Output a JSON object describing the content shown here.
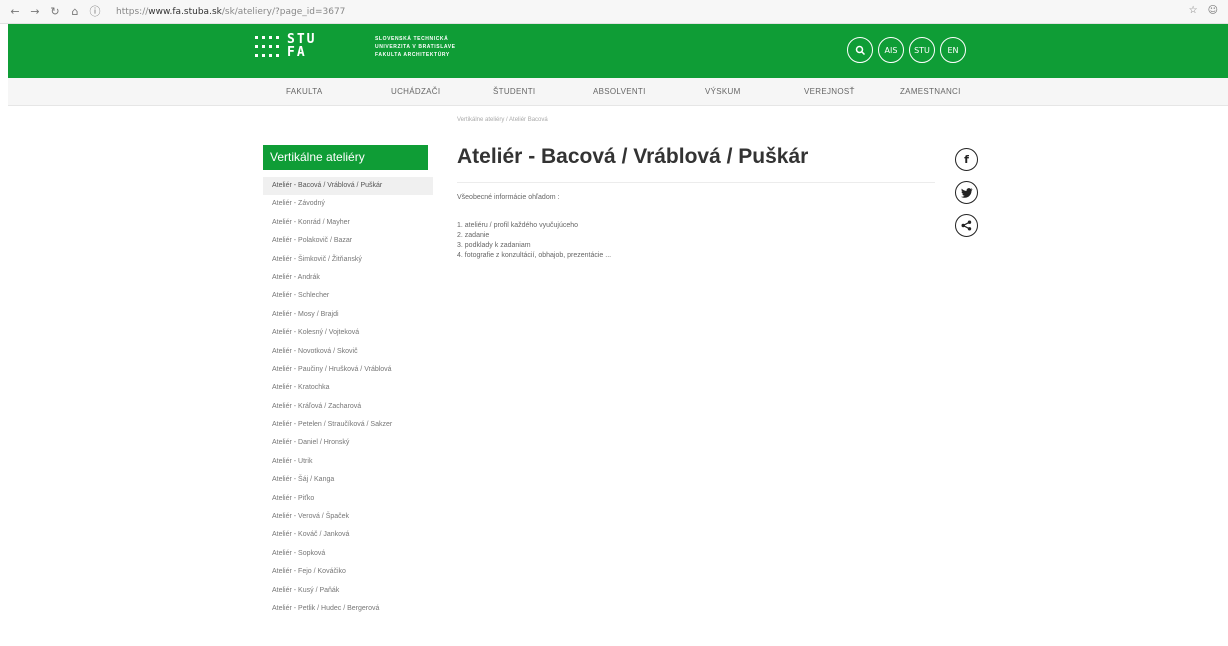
{
  "browser": {
    "url_prefix": "https://",
    "url_domain": "www.fa.stuba.sk",
    "url_path": "/sk/ateliery/?page_id=3677"
  },
  "header": {
    "logo_line1": "STU",
    "logo_line2": "FA",
    "faculty_lines": [
      "SLOVENSKÁ TECHNICKÁ",
      "UNIVERZITA V BRATISLAVE",
      "FAKULTA ARCHITEKTÚRY"
    ],
    "buttons": [
      "AIS",
      "STU",
      "EN"
    ]
  },
  "nav": {
    "items": [
      "FAKULTA",
      "UCHÁDZAČI",
      "ŠTUDENTI",
      "ABSOLVENTI",
      "VÝSKUM",
      "VEREJNOSŤ",
      "ZAMESTNANCI"
    ]
  },
  "breadcrumb": "Vertikálne ateliéry  /  Ateliér Bacová",
  "sidebar": {
    "title": "Vertikálne ateliéry",
    "items": [
      "Ateliér - Bacová / Vráblová / Puškár",
      "Ateliér - Závodný",
      "Ateliér - Konrád / Mayher",
      "Ateliér - Polakovič / Bazar",
      "Ateliér - Šimkovič / Žitňanský",
      "Ateliér - Andrák",
      "Ateliér - Schlecher",
      "Ateliér - Mosy / Brajdi",
      "Ateliér - Kolesný / Vojteková",
      "Ateliér - Novotková / Skovič",
      "Ateliér - Paučiny / Hrušková / Vráblová",
      "Ateliér - Kratochka",
      "Ateliér - Kráľová / Zacharová",
      "Ateliér - Petelen / Straučíková / Sakzer",
      "Ateliér - Daniel / Hronský",
      "Ateliér - Utrik",
      "Ateliér - Šáj / Kanga",
      "Ateliér - Piťko",
      "Ateliér - Verová / Špaček",
      "Ateliér - Kováč / Janková",
      "Ateliér - Sopková",
      "Ateliér - Fejo / Kováčiko",
      "Ateliér - Kusý / Paňák",
      "Ateliér - Petlik / Hudec / Bergerová"
    ]
  },
  "content": {
    "title": "Ateliér - Bacová / Vráblová / Puškár",
    "intro": "Všeobecné informácie ohľadom :",
    "points": [
      "1. ateliéru / profil každého vyučujúceho",
      "2. zadanie",
      "3. podklady k zadaniam",
      "4. fotografie z konzultácií, obhajob, prezentácie ..."
    ]
  },
  "social": [
    "f",
    "t",
    "share"
  ]
}
